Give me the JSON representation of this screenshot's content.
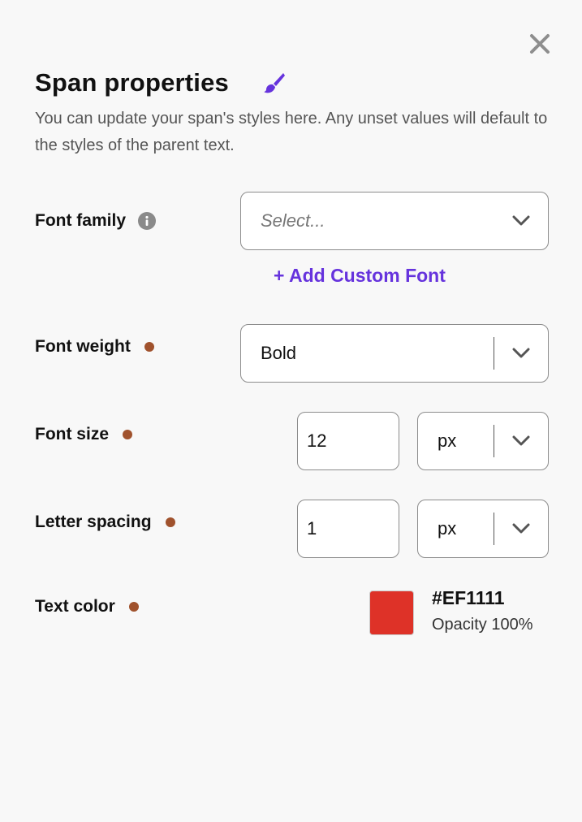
{
  "header": {
    "title": "Span properties",
    "subtitle": "You can update your span's styles here. Any unset values will default to the styles of the parent text.",
    "close_icon": "close-icon",
    "title_icon": "paintbrush-icon"
  },
  "font_family": {
    "label": "Font family",
    "placeholder": "Select...",
    "info_icon": "info-icon",
    "add_custom_font_label": "+ Add Custom Font"
  },
  "font_weight": {
    "label": "Font weight",
    "value": "Bold"
  },
  "font_size": {
    "label": "Font size",
    "value": "12",
    "unit": "px"
  },
  "letter_spacing": {
    "label": "Letter spacing",
    "value": "1",
    "unit": "px"
  },
  "text_color": {
    "label": "Text color",
    "hex": "#EF1111",
    "opacity_text": "Opacity 100%"
  },
  "colors": {
    "accent": "#6633DD",
    "set_indicator": "#A0522D",
    "swatch_rendered": "#DE3228"
  }
}
